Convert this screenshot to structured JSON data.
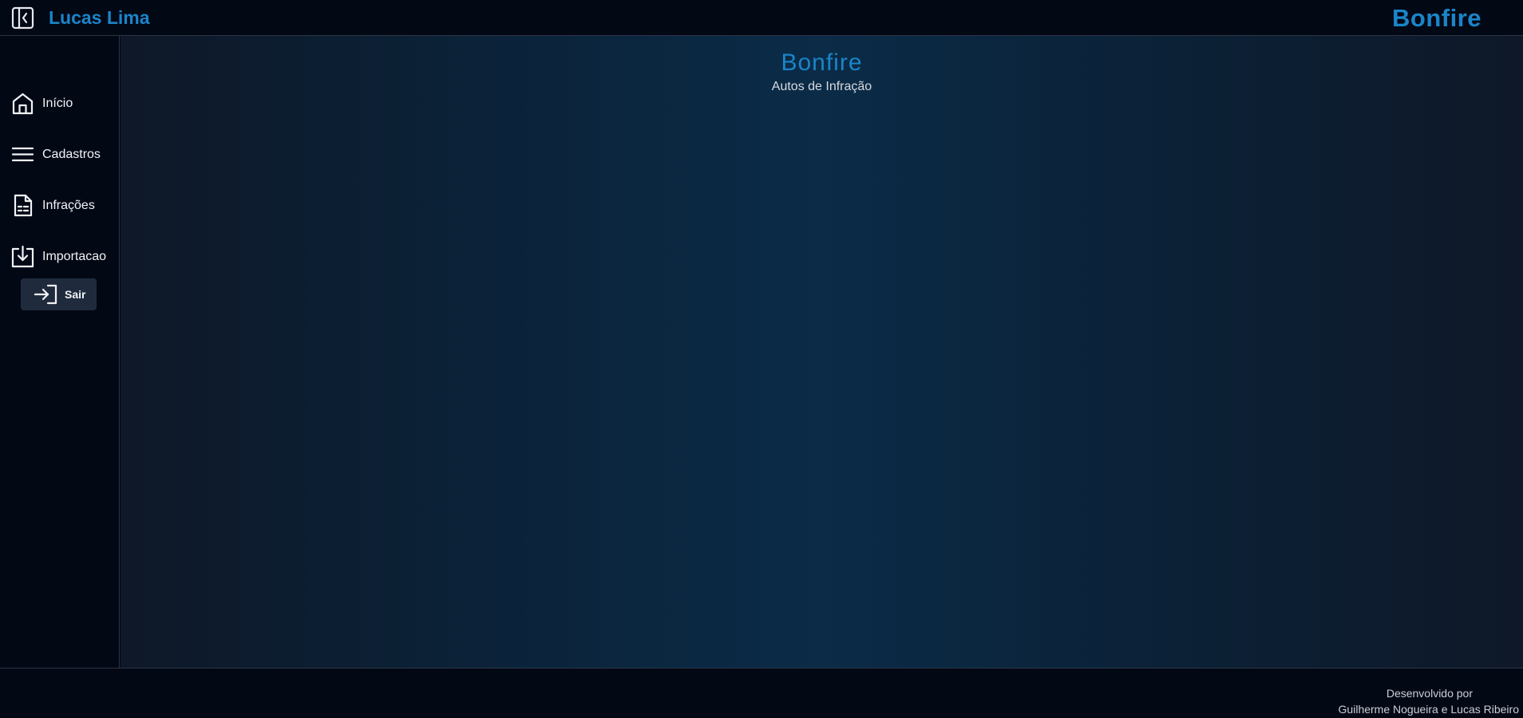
{
  "header": {
    "user_name": "Lucas Lima",
    "brand": "Bonfire"
  },
  "sidebar": {
    "items": [
      {
        "label": "Início",
        "icon": "home-icon"
      },
      {
        "label": "Cadastros",
        "icon": "menu-lines-icon"
      },
      {
        "label": "Infrações",
        "icon": "document-list-icon"
      },
      {
        "label": "Importacao",
        "icon": "download-box-icon"
      }
    ],
    "exit_label": "Sair",
    "exit_icon": "sign-in-arrow-icon"
  },
  "main": {
    "title": "Bonfire",
    "subtitle": "Autos de Infração"
  },
  "footer": {
    "line1": "Desenvolvido por",
    "line2": "Guilherme Nogueira e Lucas Ribeiro"
  },
  "colors": {
    "accent": "#1a85c9",
    "background": "#030815",
    "exit_button": "#1f2b3d"
  }
}
